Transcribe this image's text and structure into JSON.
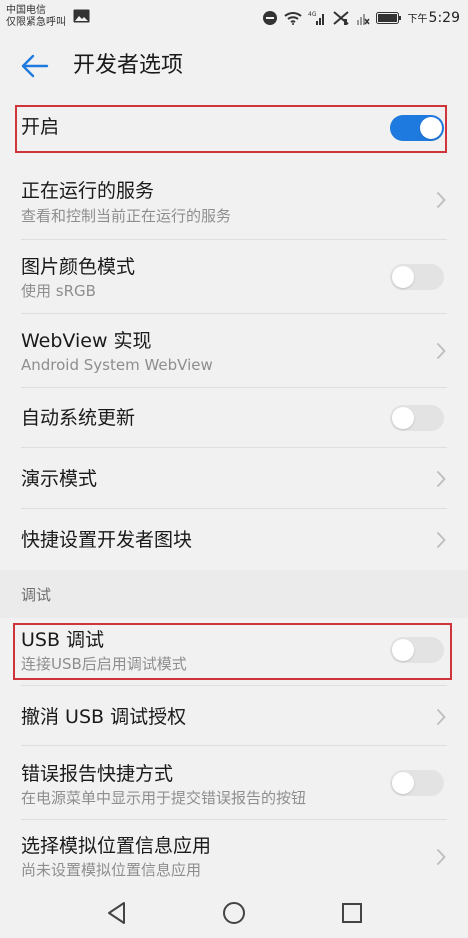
{
  "status_bar": {
    "carrier_line1": "中国电信",
    "carrier_line2": "仅限紧急呼叫",
    "time_prefix": "下午",
    "time": "5:29",
    "icons": [
      "image-icon",
      "do-not-disturb-icon",
      "wifi-icon",
      "signal-icon",
      "no-signal-icon",
      "no-sim-signal-icon",
      "battery-icon"
    ]
  },
  "app_bar": {
    "title": "开发者选项",
    "back_icon": "back-arrow-icon"
  },
  "colors": {
    "accent": "#1f7ae0",
    "highlight": "#d0343b",
    "background": "#f1f1f1"
  },
  "items": [
    {
      "title": "开启",
      "subtitle": "",
      "control": "toggle",
      "on": true
    },
    {
      "title": "正在运行的服务",
      "subtitle": "查看和控制当前正在运行的服务",
      "control": "chevron"
    },
    {
      "title": "图片颜色模式",
      "subtitle": "使用 sRGB",
      "control": "toggle",
      "on": false
    },
    {
      "title": "WebView 实现",
      "subtitle": "Android System WebView",
      "control": "chevron"
    },
    {
      "title": "自动系统更新",
      "subtitle": "",
      "control": "toggle",
      "on": false
    },
    {
      "title": "演示模式",
      "subtitle": "",
      "control": "chevron"
    },
    {
      "title": "快捷设置开发者图块",
      "subtitle": "",
      "control": "chevron"
    }
  ],
  "debug_section": {
    "header": "调试",
    "items": [
      {
        "title": "USB 调试",
        "subtitle": "连接USB后启用调试模式",
        "control": "toggle",
        "on": false
      },
      {
        "title": "撤消 USB 调试授权",
        "subtitle": "",
        "control": "chevron"
      },
      {
        "title": "错误报告快捷方式",
        "subtitle": "在电源菜单中显示用于提交错误报告的按钮",
        "control": "toggle",
        "on": false
      },
      {
        "title": "选择模拟位置信息应用",
        "subtitle": "尚未设置模拟位置信息应用",
        "control": "chevron"
      }
    ]
  },
  "nav_bar": {
    "icons": [
      "back-triangle-icon",
      "home-circle-icon",
      "recents-square-icon"
    ]
  }
}
